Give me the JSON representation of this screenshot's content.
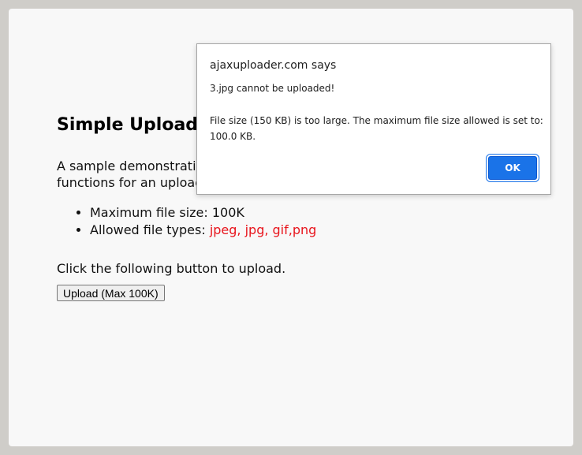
{
  "page": {
    "title": "Simple Upload",
    "description_line1": "A sample demonstrating",
    "description_line2": "functions for an upload",
    "features": {
      "max_size_label": "Maximum file size: 100K",
      "allowed_types_prefix": "Allowed file types: ",
      "allowed_types_value": "jpeg, jpg, gif,png"
    },
    "instruction": "Click the following button to upload.",
    "upload_button_label": "Upload (Max 100K)"
  },
  "dialog": {
    "title": "ajaxuploader.com says",
    "message_line1": "3.jpg cannot be uploaded!",
    "message_line2": "File size (150 KB) is too large. The maximum file size allowed is set to:",
    "message_line3": "100.0 KB.",
    "ok_label": "OK"
  },
  "colors": {
    "background": "#cfcdc9",
    "page": "#f8f8f8",
    "highlight": "#e8141c",
    "ok_button": "#1a73e8"
  }
}
